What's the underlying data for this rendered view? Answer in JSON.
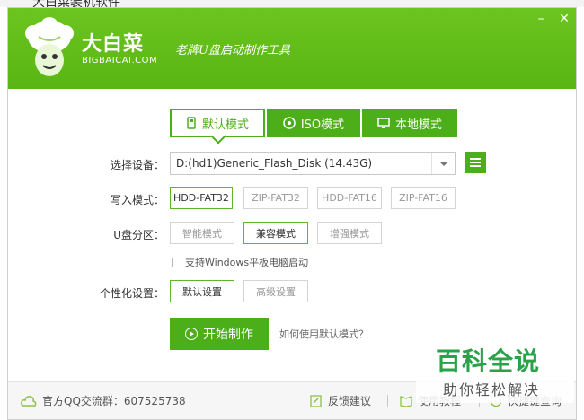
{
  "outer_title": "大白菜装机软件",
  "header": {
    "brand_name": "大白菜",
    "brand_domain": "BIGBAICAI.COM",
    "slogan": "老牌U盘启动制作工具",
    "minimize_label": "–",
    "close_label": "✕"
  },
  "mode_tabs": [
    {
      "label": "默认模式",
      "icon": "usb-drive-icon",
      "active": true
    },
    {
      "label": "ISO模式",
      "icon": "disc-icon",
      "active": false
    },
    {
      "label": "本地模式",
      "icon": "monitor-icon",
      "active": false
    }
  ],
  "device": {
    "label": "选择设备：",
    "value": "D:(hd1)Generic_Flash_Disk (14.43G)"
  },
  "write_mode": {
    "label": "写入模式：",
    "options": [
      "HDD-FAT32",
      "ZIP-FAT32",
      "HDD-FAT16",
      "ZIP-FAT16"
    ],
    "selected": "HDD-FAT32"
  },
  "partition": {
    "label": "U盘分区：",
    "options": [
      "智能模式",
      "兼容模式",
      "增强模式"
    ],
    "selected": "兼容模式"
  },
  "windows_tablet": {
    "label": "支持Windows平板电脑启动",
    "checked": false
  },
  "personalize": {
    "label": "个性化设置：",
    "options": [
      "默认设置",
      "高级设置"
    ],
    "selected": "默认设置"
  },
  "actions": {
    "start_label": "开始制作",
    "help_link": "如何使用默认模式？"
  },
  "footer": {
    "qq_group": "官方QQ交流群：607525738",
    "feedback": "反馈建议",
    "tutorial": "使用教程",
    "shortcut": "快捷键查询"
  },
  "watermark": {
    "title": "百科全说",
    "subtitle": "助你轻松解决"
  },
  "colors": {
    "brand_green": "#58b513",
    "accent_green": "#4caf1a",
    "watermark_green": "#2aa24a"
  }
}
